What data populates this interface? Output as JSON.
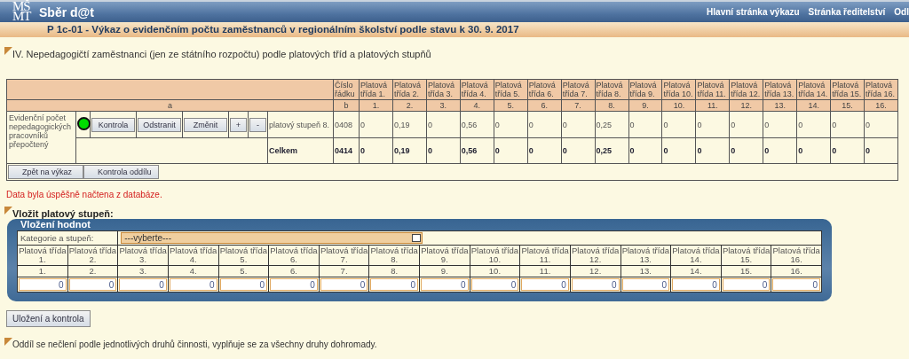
{
  "header": {
    "logo": "MŠMT",
    "app_name": "Sběr d@t",
    "nav_links": [
      "Hlavní stránka výkazu",
      "Stránka ředitelství",
      "Odl"
    ]
  },
  "report_title": "P 1c-01 - Výkaz o evidenčním počtu zaměstnanců v regionálním školství podle stavu k 30. 9. 2017",
  "section_title": "IV. Nepedagogičtí zaměstnanci (jen ze státního rozpočtu) podle platových tříd a platových stupňů",
  "table": {
    "label_column_header": "a",
    "row_number_header": "Číslo řádku",
    "row_number_code": "b",
    "columns": [
      {
        "title": "Platová třída 1.",
        "code": "1."
      },
      {
        "title": "Platová třída 2.",
        "code": "2."
      },
      {
        "title": "Platová třída 3.",
        "code": "3."
      },
      {
        "title": "Platová třída 4.",
        "code": "4."
      },
      {
        "title": "Platová třída 5.",
        "code": "5."
      },
      {
        "title": "Platová třída 6.",
        "code": "6."
      },
      {
        "title": "Platová třída 7.",
        "code": "7."
      },
      {
        "title": "Platová třída 8.",
        "code": "8."
      },
      {
        "title": "Platová třída 9.",
        "code": "9."
      },
      {
        "title": "Platová třída 10.",
        "code": "10."
      },
      {
        "title": "Platová třída 11.",
        "code": "11."
      },
      {
        "title": "Platová třída 12.",
        "code": "12."
      },
      {
        "title": "Platová třída 13.",
        "code": "13."
      },
      {
        "title": "Platová třída 14.",
        "code": "14."
      },
      {
        "title": "Platová třída 15.",
        "code": "15."
      },
      {
        "title": "Platová třída 16.",
        "code": "16."
      }
    ],
    "row_label": "Evidenční počet nepedagogických pracovníků přepočtený",
    "rows": [
      {
        "kind": "item",
        "color": "#00dd00",
        "actions": [
          "Kontrola",
          "Odstranit",
          "Změnit",
          "+",
          "-"
        ],
        "name": "platový stupeň 8.",
        "row_number": "0408",
        "values": [
          "0",
          "0,19",
          "0",
          "0,56",
          "0",
          "0",
          "0",
          "0,25",
          "0",
          "0",
          "0",
          "0",
          "0",
          "0",
          "0",
          "0"
        ]
      },
      {
        "kind": "total",
        "name": "Celkem",
        "row_number": "0414",
        "values": [
          "0",
          "0,19",
          "0",
          "0,56",
          "0",
          "0",
          "0",
          "0,25",
          "0",
          "0",
          "0",
          "0",
          "0",
          "0",
          "0",
          "0"
        ]
      }
    ],
    "buttons": [
      "Zpět na výkaz",
      "Kontrola oddílu"
    ]
  },
  "message": "Data byla úspěšně načtena z databáze.",
  "insert": {
    "heading": "Vložit platový stupeň:",
    "panel_title": "Vložení hodnot",
    "category_label": "Kategorie a stupeň:",
    "category_value": "---vyberte---",
    "columns": [
      {
        "title": "Platová třída 1.",
        "code": "1.",
        "value": "0"
      },
      {
        "title": "Platová třída 2.",
        "code": "2.",
        "value": "0"
      },
      {
        "title": "Platová třída 3.",
        "code": "3.",
        "value": "0"
      },
      {
        "title": "Platová třída 4.",
        "code": "4.",
        "value": "0"
      },
      {
        "title": "Platová třída 5.",
        "code": "5.",
        "value": "0"
      },
      {
        "title": "Platová třída 6.",
        "code": "6.",
        "value": "0"
      },
      {
        "title": "Platová třída 7.",
        "code": "7.",
        "value": "0"
      },
      {
        "title": "Platová třída 8.",
        "code": "8.",
        "value": "0"
      },
      {
        "title": "Platová třída 9.",
        "code": "9.",
        "value": "0"
      },
      {
        "title": "Platová třída 10.",
        "code": "10.",
        "value": "0"
      },
      {
        "title": "Platová třída 11.",
        "code": "11.",
        "value": "0"
      },
      {
        "title": "Platová třída 12.",
        "code": "12.",
        "value": "0"
      },
      {
        "title": "Platová třída 13.",
        "code": "13.",
        "value": "0"
      },
      {
        "title": "Platová třída 14.",
        "code": "14.",
        "value": "0"
      },
      {
        "title": "Platová třída 15.",
        "code": "15.",
        "value": "0"
      },
      {
        "title": "Platová třída 16.",
        "code": "16.",
        "value": "0"
      }
    ]
  },
  "save_button": "Uložení a kontrola",
  "note": "Oddíl se nečlení podle jednotlivých druhů činnosti, vyplňuje se za všechny druhy dohromady."
}
